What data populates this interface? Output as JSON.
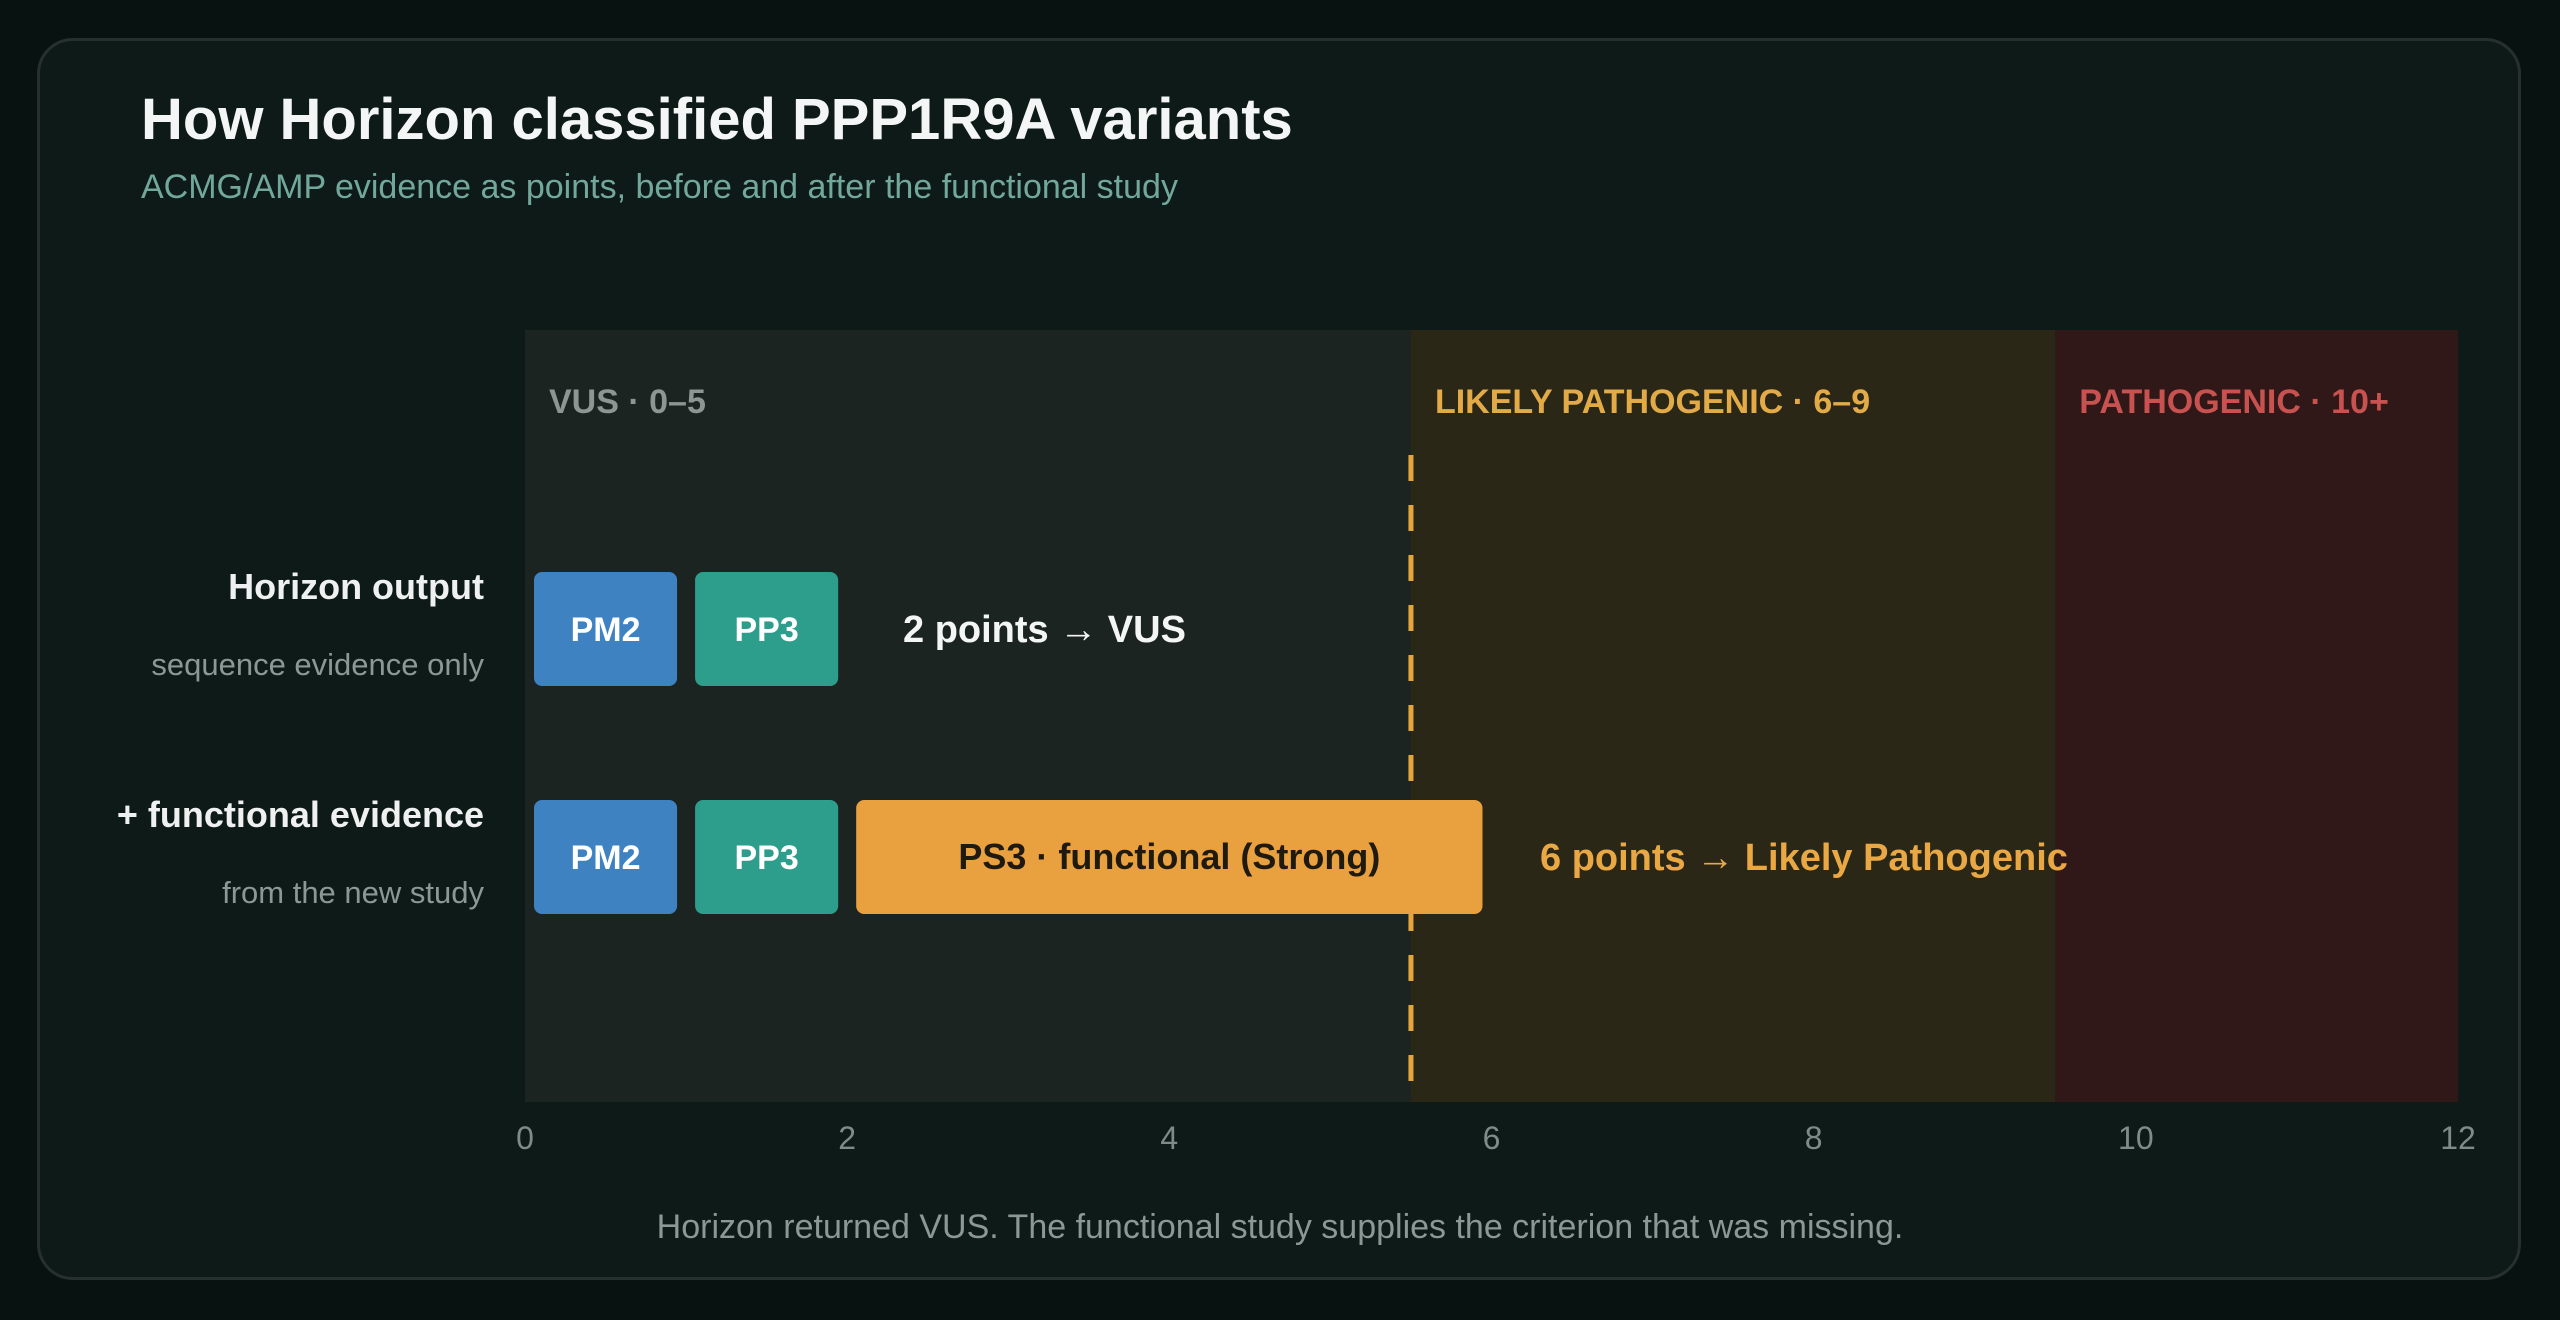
{
  "title": "How Horizon classified PPP1R9A variants",
  "subtitle": "ACMG/AMP evidence as points, before and after the functional study",
  "caption": "Horizon returned VUS. The functional study supplies the criterion that was missing.",
  "colors": {
    "background": "#081210",
    "card": "#0d1a17",
    "pm2": "#3f82c2",
    "pp3": "#2e9e8c",
    "ps3": "#e9a03f",
    "vus_zone": "#1c2421",
    "likely_pathogenic_zone": "#2a2716",
    "pathogenic_zone": "#301819",
    "vus_label": "#8d9692",
    "likely_pathogenic_label": "#e3ab48",
    "pathogenic_label": "#c7524f",
    "threshold": "#e5a63e"
  },
  "chart_data": {
    "type": "bar",
    "orientation": "horizontal",
    "stacked": true,
    "title": "How Horizon classified PPP1R9A variants",
    "subtitle": "ACMG/AMP evidence as points, before and after the functional study",
    "xlim": [
      0,
      12
    ],
    "x_ticks": [
      0,
      2,
      4,
      6,
      8,
      10,
      12
    ],
    "threshold_line": 5.5,
    "zones": [
      {
        "label": "VUS · 0–5",
        "start": 0,
        "end": 5.5,
        "color": "#1c2421",
        "label_color": "#8d9692"
      },
      {
        "label": "LIKELY PATHOGENIC · 6–9",
        "start": 5.5,
        "end": 9.5,
        "color": "#2a2716",
        "label_color": "#e3ab48"
      },
      {
        "label": "PATHOGENIC · 10+",
        "start": 9.5,
        "end": 12,
        "color": "#301819",
        "label_color": "#c7524f"
      }
    ],
    "rows": [
      {
        "label": "Horizon output",
        "sublabel": "sequence evidence only",
        "total_text": "2 points  →  VUS",
        "total_color": "#f4f6f5",
        "segments": [
          {
            "name": "PM2",
            "start": 0,
            "value": 1,
            "color": "#3f82c2",
            "text_color": "#ffffff"
          },
          {
            "name": "PP3",
            "start": 1,
            "value": 1,
            "color": "#2e9e8c",
            "text_color": "#ffffff"
          }
        ]
      },
      {
        "label": "+ functional evidence",
        "sublabel": "from the new study",
        "total_text": "6 points  →  Likely Pathogenic",
        "total_color": "#e9a844",
        "segments": [
          {
            "name": "PM2",
            "start": 0,
            "value": 1,
            "color": "#3f82c2",
            "text_color": "#ffffff"
          },
          {
            "name": "PP3",
            "start": 1,
            "value": 1,
            "color": "#2e9e8c",
            "text_color": "#ffffff"
          },
          {
            "name": "PS3  ·  functional (Strong)",
            "start": 2,
            "value": 4,
            "color": "#e9a03f",
            "text_color": "#1f1a10"
          }
        ]
      }
    ]
  }
}
